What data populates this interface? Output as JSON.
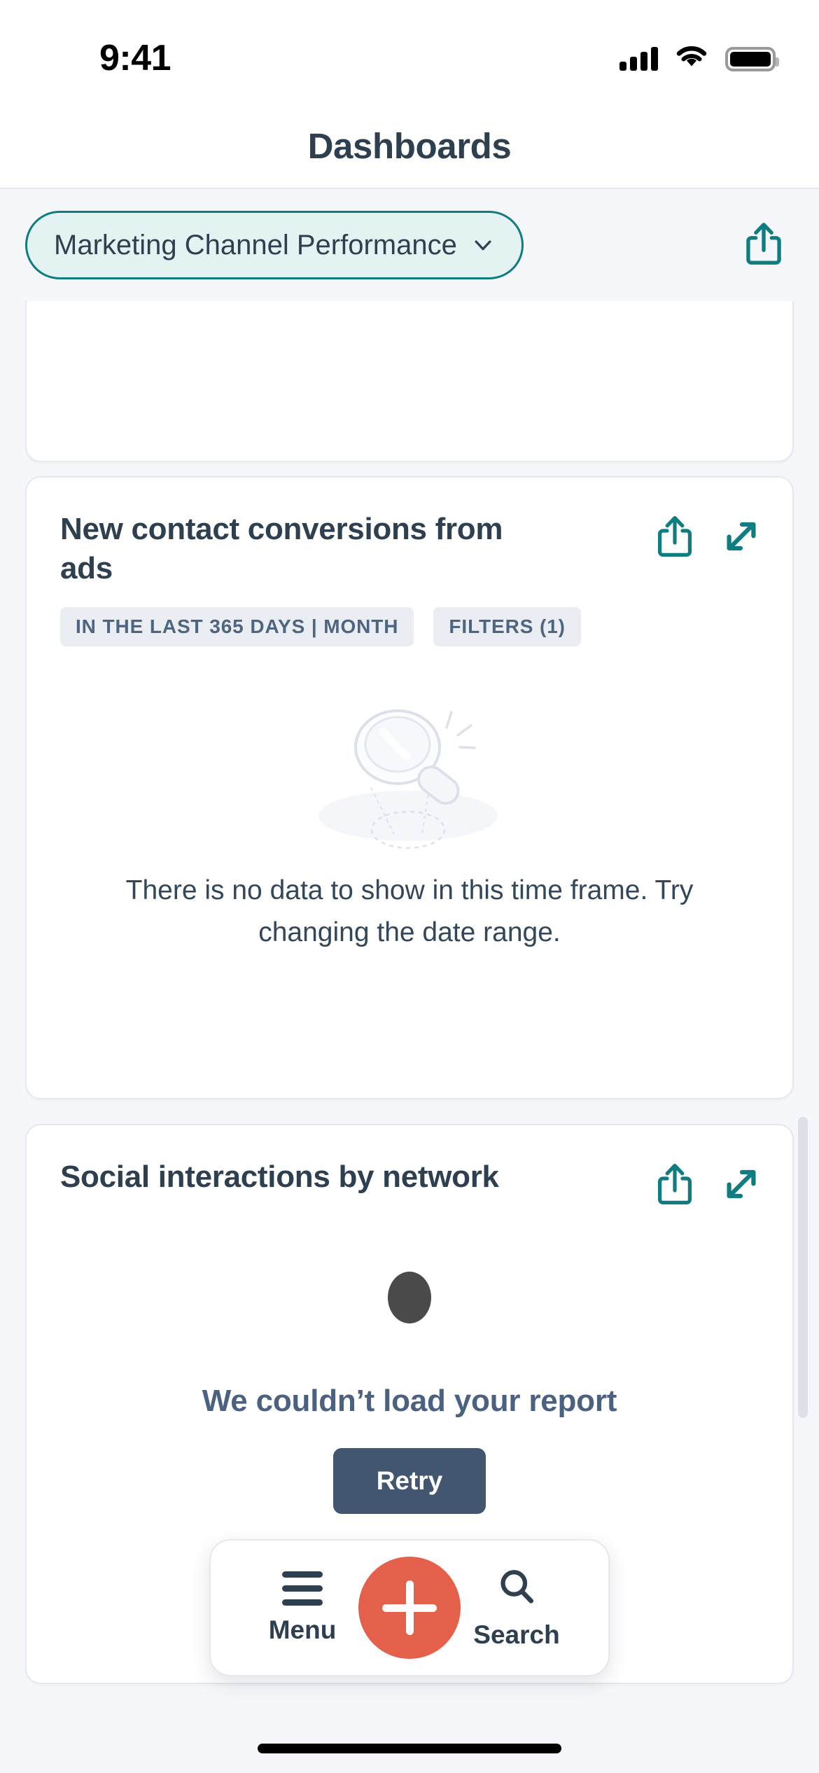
{
  "status_bar": {
    "time": "9:41",
    "cellular_icon": "cellular-signal-icon",
    "wifi_icon": "wifi-icon",
    "battery_icon": "battery-full-icon"
  },
  "header": {
    "title": "Dashboards"
  },
  "selector": {
    "dashboard_name": "Marketing Channel Performance",
    "chevron_icon": "chevron-down-icon",
    "share_icon": "share-icon",
    "accent_color": "#0E7C80",
    "pill_fill": "#E3F3F2"
  },
  "cards": [
    {
      "id": "partial-top-card",
      "title": "",
      "state": "partial"
    },
    {
      "id": "new-contact-conversions-from-ads",
      "title": "New contact conversions from ads",
      "badges": [
        "IN THE LAST 365 DAYS | MONTH",
        "FILTERS (1)"
      ],
      "share_icon": "share-icon",
      "expand_icon": "expand-diagonal-icon",
      "state": "empty",
      "empty_message": "There is no data to show in this time frame. Try changing the date range.",
      "illustration": "magnifying-glass-empty-state-illustration"
    },
    {
      "id": "social-interactions-by-network",
      "title": "Social interactions by network",
      "share_icon": "share-icon",
      "expand_icon": "expand-diagonal-icon",
      "state": "error",
      "error_message": "We couldn’t load your report",
      "retry_label": "Retry",
      "retry_color": "#42576F"
    }
  ],
  "bottom_nav": {
    "menu_label": "Menu",
    "menu_icon": "hamburger-menu-icon",
    "create_icon": "plus-icon",
    "create_color": "#E4604B",
    "search_label": "Search",
    "search_icon": "search-icon"
  }
}
